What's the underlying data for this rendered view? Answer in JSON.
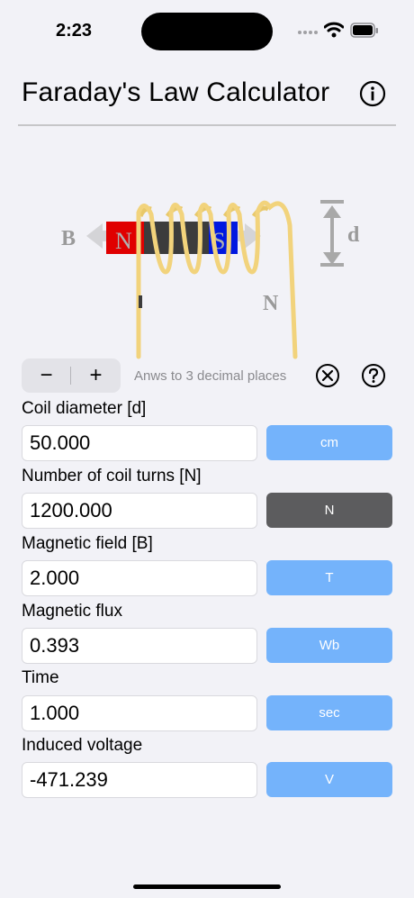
{
  "status": {
    "time": "2:23"
  },
  "nav": {
    "title": "Faraday's Law Calculator"
  },
  "diagram": {
    "label_b": "B",
    "label_n_pole": "N",
    "label_s_pole": "S",
    "label_d": "d",
    "label_turns": "N"
  },
  "controls": {
    "minus": "−",
    "plus": "+",
    "precision_note": "Anws to 3 decimal places"
  },
  "fields": [
    {
      "label": "Coil diameter [d]",
      "value": "50.000",
      "unit": "cm",
      "selected": false
    },
    {
      "label": "Number of coil turns [N]",
      "value": "1200.000",
      "unit": "N",
      "selected": true
    },
    {
      "label": "Magnetic field [B]",
      "value": "2.000",
      "unit": "T",
      "selected": false
    },
    {
      "label": "Magnetic flux",
      "value": "0.393",
      "unit": "Wb",
      "selected": false
    },
    {
      "label": "Time",
      "value": "1.000",
      "unit": "sec",
      "selected": false
    },
    {
      "label": "Induced voltage",
      "value": "-471.239",
      "unit": "V",
      "selected": false
    }
  ],
  "colors": {
    "unit_button": "#74b3fb",
    "unit_button_selected": "#5c5c5e",
    "magnet_north": "#e00000",
    "magnet_south": "#0018e0",
    "coil": "#f2d37c"
  }
}
